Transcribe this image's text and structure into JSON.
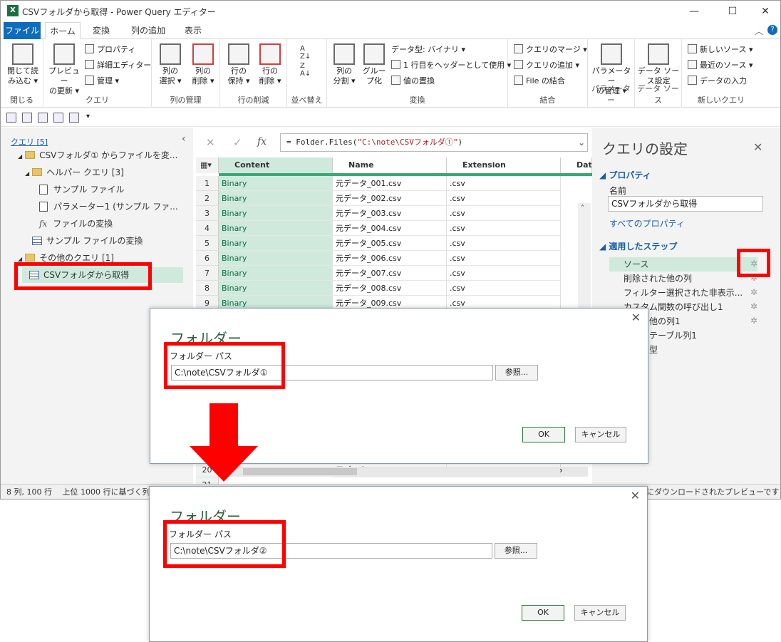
{
  "window": {
    "title": "CSVフォルダから取得 - Power Query エディター",
    "app_icon": "X"
  },
  "ribbon_tabs": [
    "ファイル",
    "ホーム",
    "変換",
    "列の追加",
    "表示"
  ],
  "ribbon": {
    "close": {
      "label1": "閉じて読",
      "label2": "み込む ▾",
      "group": "閉じる"
    },
    "query": {
      "refresh1": "プレビュー",
      "refresh2": "の更新 ▾",
      "properties": "プロパティ",
      "advanced_editor": "詳細エディター",
      "manage": "管理 ▾",
      "group": "クエリ"
    },
    "manage_cols": {
      "choose1": "列の",
      "choose2": "選択 ▾",
      "remove1": "列の",
      "remove2": "削除 ▾",
      "group": "列の管理"
    },
    "reduce_rows": {
      "keep1": "行の",
      "keep2": "保持 ▾",
      "remove1": "行の",
      "remove2": "削除 ▾",
      "group": "行の削減"
    },
    "sort": {
      "group": "並べ替え"
    },
    "transform": {
      "split1": "列の",
      "split2": "分割 ▾",
      "groupby1": "グルー",
      "groupby2": "プ化",
      "datatype": "データ型: バイナリ ▾",
      "first_row": "1 行目をヘッダーとして使用 ▾",
      "replace": "値の置換",
      "group": "変換"
    },
    "combine": {
      "merge": "クエリのマージ ▾",
      "append": "クエリの追加 ▾",
      "combine_files": "File の結合",
      "group": "結合"
    },
    "params": {
      "manage1": "パラメーター",
      "manage2": "の管理 ▾",
      "group": "パラメーター"
    },
    "datasource": {
      "settings1": "データ ソー",
      "settings2": "ス設定",
      "group": "データ ソース"
    },
    "newquery": {
      "new_source": "新しいソース ▾",
      "recent": "最近のソース ▾",
      "enter_data": "データの入力",
      "group": "新しいクエリ"
    }
  },
  "queries_pane": {
    "header": "クエリ [5]",
    "items": [
      "CSVフォルダ① からファイルを変...",
      "ヘルパー クエリ [3]",
      "サンプル ファイル",
      "パラメーター1 (サンプル ファ...",
      "ファイルの変換",
      "サンプル ファイルの変換",
      "その他のクエリ [1]",
      "CSVフォルダから取得"
    ]
  },
  "formula": {
    "cancel": "✕",
    "confirm": "✓",
    "fx": "fx",
    "prefix": "= Folder.Files(",
    "arg": "\"C:\\note\\CSVフォルダ①\"",
    "suffix": ")"
  },
  "grid": {
    "columns": [
      "Content",
      "Name",
      "Extension",
      "Dat"
    ],
    "rows": [
      {
        "n": "1",
        "content": "Binary",
        "name": "元データ_001.csv",
        "ext": ".csv"
      },
      {
        "n": "2",
        "content": "Binary",
        "name": "元データ_002.csv",
        "ext": ".csv"
      },
      {
        "n": "3",
        "content": "Binary",
        "name": "元データ_003.csv",
        "ext": ".csv"
      },
      {
        "n": "4",
        "content": "Binary",
        "name": "元データ_004.csv",
        "ext": ".csv"
      },
      {
        "n": "5",
        "content": "Binary",
        "name": "元データ_005.csv",
        "ext": ".csv"
      },
      {
        "n": "6",
        "content": "Binary",
        "name": "元データ_006.csv",
        "ext": ".csv"
      },
      {
        "n": "7",
        "content": "Binary",
        "name": "元データ_007.csv",
        "ext": ".csv"
      },
      {
        "n": "8",
        "content": "Binary",
        "name": "元データ_008.csv",
        "ext": ".csv"
      },
      {
        "n": "9",
        "content": "Binary",
        "name": "元データ_009.csv",
        "ext": ".csv"
      }
    ],
    "row20": {
      "n": "20",
      "name": "元データ_020.csv",
      "ext": ".csv"
    },
    "row21": "21"
  },
  "settings": {
    "title": "クエリの設定",
    "properties_header": "プロパティ",
    "name_label": "名前",
    "name_value": "CSVフォルダから取得",
    "all_props": "すべてのプロパティ",
    "steps_header": "適用したステップ",
    "steps": [
      "ソース",
      "削除された他の列",
      "フィルター選択された非表示...",
      "カスタム関数の呼び出し1",
      "された他の列1",
      "されたテーブル列1",
      "された型"
    ]
  },
  "statusbar": {
    "left": "8 列, 100 行　 上位 1000 行に基づく列の",
    "right": "にダウンロードされたプレビューです"
  },
  "dialog1": {
    "title": "フォルダー",
    "label": "フォルダー パス",
    "path": "C:\\note\\CSVフォルダ①",
    "browse": "参照...",
    "ok": "OK",
    "cancel": "キャンセル"
  },
  "dialog2": {
    "title": "フォルダー",
    "label": "フォルダー パス",
    "path": "C:\\note\\CSVフォルダ②",
    "browse": "参照...",
    "ok": "OK",
    "cancel": "キャンセル"
  },
  "colors": {
    "highlight": "#ff0000",
    "file_tab": "#0f6cbd",
    "binary_bg": "#cfeadd",
    "dialog_title": "#2a5f3a"
  }
}
